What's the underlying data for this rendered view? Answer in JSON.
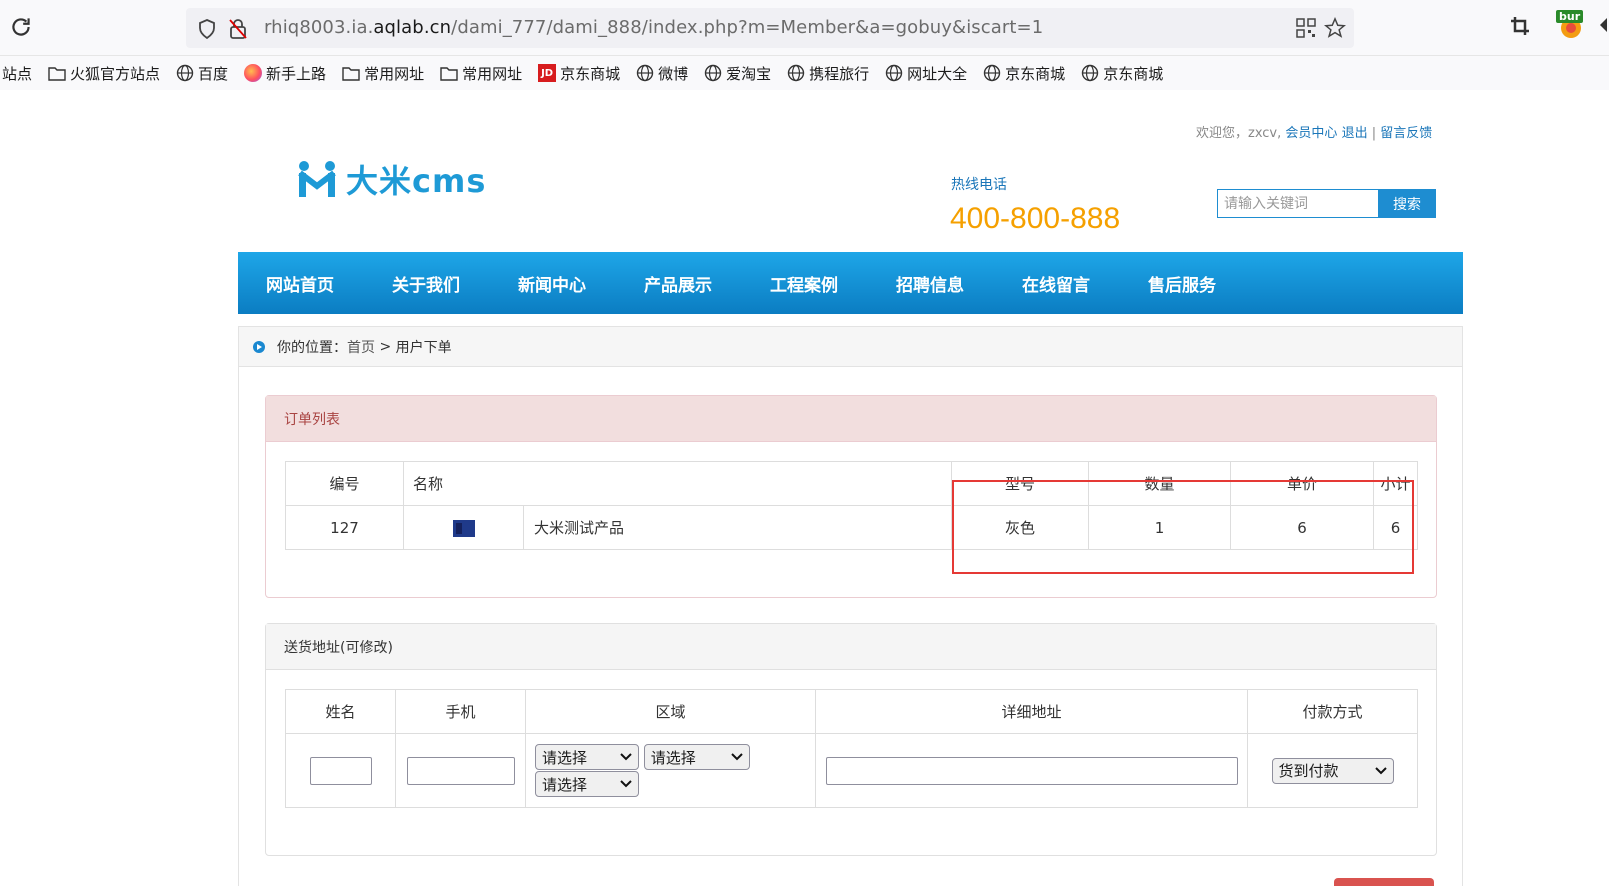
{
  "browser": {
    "url_prefix": "rhiq8003.ia.",
    "url_host": "aqlab.cn",
    "url_path": "/dami_777/dami_888/index.php?m=Member&a=gobuy&iscart=1",
    "extension_badge": "bur"
  },
  "bookmarks": [
    {
      "label": "站点",
      "icon": "none"
    },
    {
      "label": "火狐官方站点",
      "icon": "folder-icon"
    },
    {
      "label": "百度",
      "icon": "globe-icon"
    },
    {
      "label": "新手上路",
      "icon": "firefox-icon"
    },
    {
      "label": "常用网址",
      "icon": "folder-icon"
    },
    {
      "label": "常用网址",
      "icon": "folder-icon"
    },
    {
      "label": "京东商城",
      "icon": "jd-icon"
    },
    {
      "label": "微博",
      "icon": "globe-icon"
    },
    {
      "label": "爱淘宝",
      "icon": "globe-icon"
    },
    {
      "label": "携程旅行",
      "icon": "globe-icon"
    },
    {
      "label": "网址大全",
      "icon": "globe-icon"
    },
    {
      "label": "京东商城",
      "icon": "globe-icon"
    },
    {
      "label": "京东商城",
      "icon": "globe-icon"
    }
  ],
  "jd_text": "JD",
  "topbar": {
    "welcome": "欢迎您，zxcv,",
    "member_center": "会员中心",
    "logout": "退出",
    "sep": "|",
    "feedback": "留言反馈"
  },
  "logo_text": "大米cms",
  "hotline": {
    "label": "热线电话",
    "number": "400-800-888"
  },
  "search": {
    "placeholder": "请输入关键词",
    "button": "搜索"
  },
  "nav": [
    "网站首页",
    "关于我们",
    "新闻中心",
    "产品展示",
    "工程案例",
    "招聘信息",
    "在线留言",
    "售后服务"
  ],
  "breadcrumb": {
    "prefix": "你的位置：",
    "home": "首页",
    "sep": " > ",
    "current": "用户下单"
  },
  "order": {
    "title": "订单列表",
    "headers": {
      "id": "编号",
      "name": "名称",
      "model": "型号",
      "qty": "数量",
      "price": "单价",
      "subtotal": "小计"
    },
    "row": {
      "id": "127",
      "name": "大米测试产品",
      "model": "灰色",
      "qty": "1",
      "price": "6",
      "subtotal": "6"
    }
  },
  "address": {
    "title": "送货地址(可修改)",
    "headers": {
      "name": "姓名",
      "phone": "手机",
      "region": "区域",
      "detail": "详细地址",
      "payment": "付款方式"
    },
    "select_placeholder": "请选择",
    "payment_value": "货到付款"
  },
  "colors": {
    "accent": "#1e8dd1",
    "hotline": "#f5a000",
    "highlight": "#e53935"
  }
}
